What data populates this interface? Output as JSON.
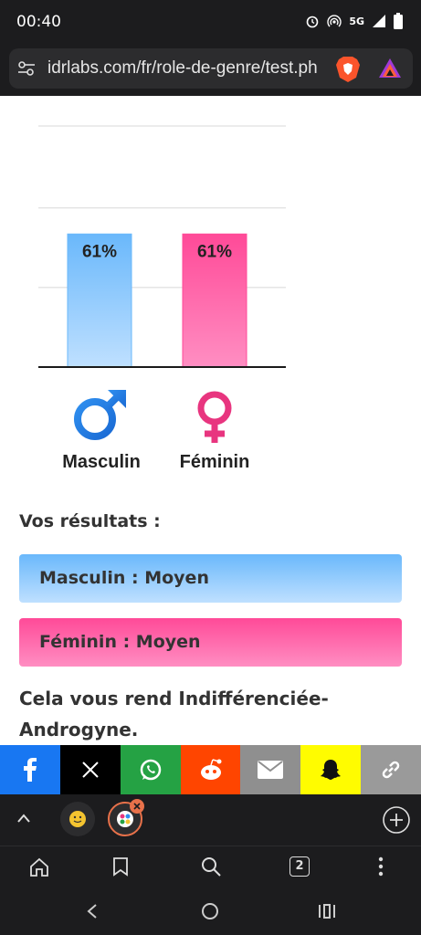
{
  "status": {
    "time": "00:40",
    "network": "5G"
  },
  "browser": {
    "url": "idrlabs.com/fr/role-de-genre/test.ph",
    "tab_count": "2"
  },
  "chart_data": {
    "type": "bar",
    "categories": [
      "Masculin",
      "Féminin"
    ],
    "values": [
      61,
      61
    ],
    "data_labels": [
      "61%",
      "61%"
    ],
    "ylim": [
      0,
      100
    ],
    "colors": [
      "#6ab8fb",
      "#ff4a98"
    ],
    "grid": true
  },
  "results": {
    "heading": "Vos résultats :",
    "masculin": "Masculin : Moyen",
    "feminin": "Féminin : Moyen",
    "conclusion": "Cela vous rend Indifférenciée-Androgyne."
  },
  "share": {
    "colors": [
      "#1877f2",
      "#000000",
      "#25a244",
      "#ff4500",
      "#8f8f8f",
      "#fffc00",
      "#9a9a9a"
    ],
    "icons": [
      "facebook-icon",
      "x-icon",
      "whatsapp-icon",
      "reddit-icon",
      "email-icon",
      "snapchat-icon",
      "link-icon"
    ]
  }
}
